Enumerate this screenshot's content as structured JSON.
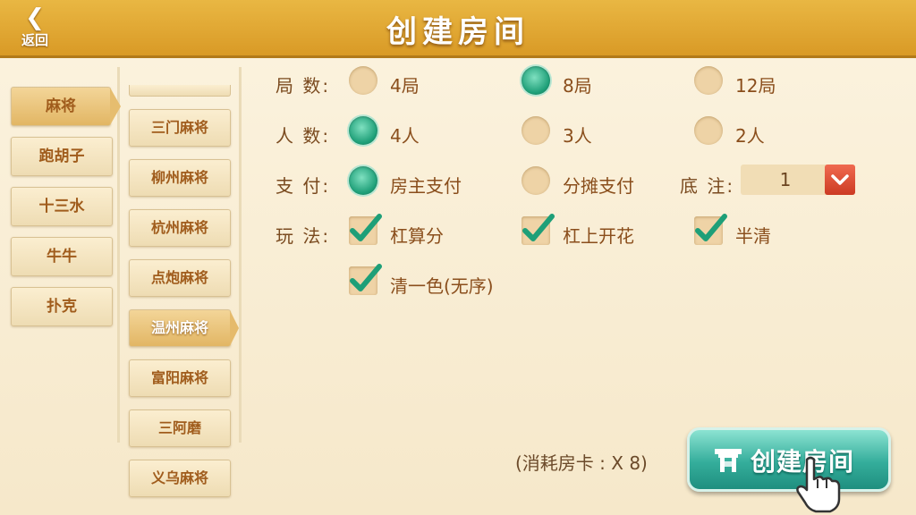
{
  "header": {
    "back_label": "返回",
    "title": "创建房间"
  },
  "categories": [
    "麻将",
    "跑胡子",
    "十三水",
    "牛牛",
    "扑克"
  ],
  "sub_games": [
    "三门麻将",
    "柳州麻将",
    "杭州麻将",
    "点炮麻将",
    "温州麻将",
    "富阳麻将",
    "三阿磨",
    "义乌麻将"
  ],
  "settings": {
    "rounds": {
      "label": "局  数:",
      "options": [
        "4局",
        "8局",
        "12局"
      ],
      "selected": "8局"
    },
    "players": {
      "label": "人  数:",
      "options": [
        "4人",
        "3人",
        "2人"
      ],
      "selected": "4人"
    },
    "payment": {
      "label": "支  付:",
      "options": [
        "房主支付",
        "分摊支付"
      ],
      "selected": "房主支付"
    },
    "base_bet": {
      "label": "底  注:",
      "value": "1"
    },
    "rules": {
      "label": "玩  法:",
      "options": [
        "杠算分",
        "杠上开花",
        "半清",
        "清一色(无序)"
      ],
      "checked": [
        "杠算分",
        "杠上开花",
        "半清",
        "清一色(无序)"
      ]
    }
  },
  "footer": {
    "cost_text": "(消耗房卡 : X 8)",
    "create_label": "创建房间"
  },
  "colors": {
    "header": "#e3a935",
    "selected_radio": "#1e9f78",
    "create_button": "#34ad9b"
  }
}
